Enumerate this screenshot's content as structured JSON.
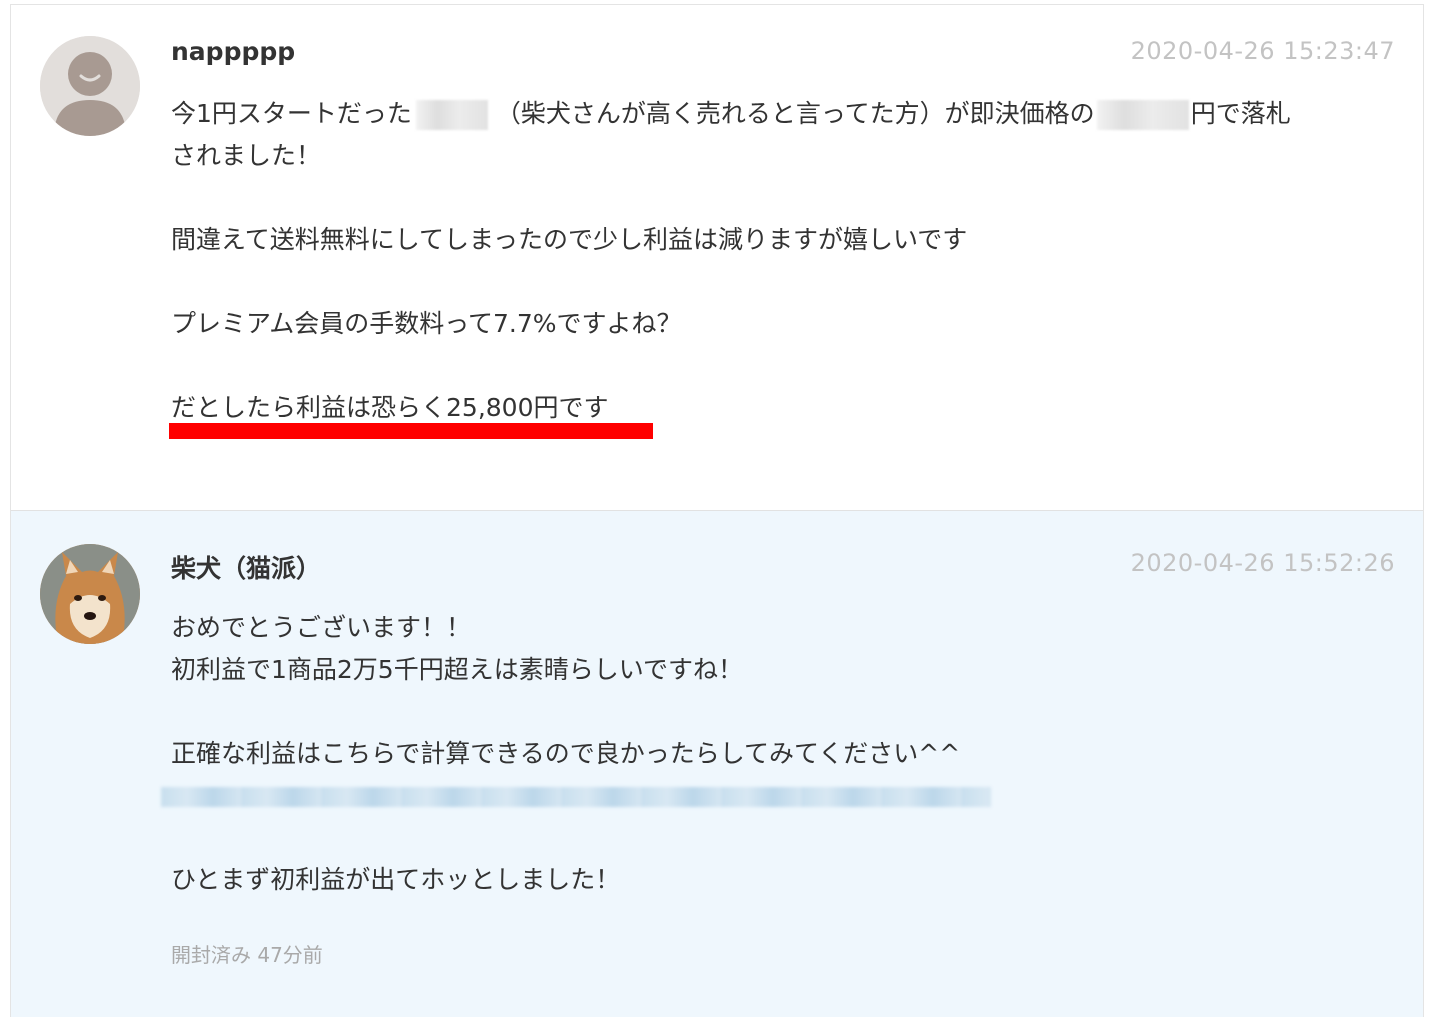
{
  "messages": [
    {
      "sender": "nappppp",
      "timestamp": "2020-04-26 15:23:47",
      "avatar": "default-user-avatar",
      "lines": [
        [
          "今1円スタートだった",
          "（柴犬さんが高く売れると言ってた方）が即決価格の",
          "円で落札"
        ],
        "されました！",
        "",
        "間違えて送料無料にしてしまったので少し利益は減りますが嬉しいです",
        "",
        "プレミアム会員の手数料って7.7%ですよね？",
        "",
        "だとしたら利益は恐らく25,800円です"
      ],
      "highlight_color": "#ff0000"
    },
    {
      "sender": "柴犬（猫派）",
      "timestamp": "2020-04-26 15:52:26",
      "avatar": "shiba-dog-avatar",
      "lines": [
        "おめでとうございます！！",
        "初利益で1商品2万5千円超えは素晴らしいですね！",
        "",
        "正確な利益はこちらで計算できるので良かったらしてみてください^^",
        "",
        "",
        "ひとまず初利益が出てホッとしました！"
      ],
      "read_status": "開封済み 47分前"
    }
  ],
  "colors": {
    "message_bg_received": "#ffffff",
    "message_bg_sent": "#eff7fd",
    "timestamp": "#c3c3c3",
    "text": "#333333"
  }
}
